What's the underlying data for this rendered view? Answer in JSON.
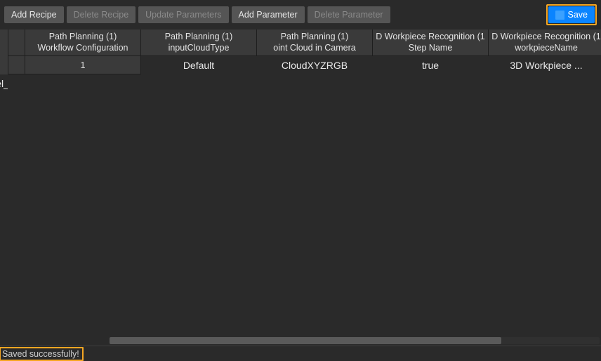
{
  "toolbar": {
    "add_recipe": "Add Recipe",
    "delete_recipe": "Delete Recipe",
    "update_parameters": "Update Parameters",
    "add_parameter": "Add Parameter",
    "delete_parameter": "Delete Parameter",
    "save": "Save"
  },
  "table": {
    "columns": [
      {
        "line1": "Path Planning (1)",
        "line2": "Workflow Configuration"
      },
      {
        "line1": "Path Planning (1)",
        "line2": "inputCloudType"
      },
      {
        "line1": "Path Planning (1)",
        "line2": "oint Cloud in Camera"
      },
      {
        "line1": "D Workpiece Recognition (1",
        "line2": "Step Name"
      },
      {
        "line1": "D Workpiece Recognition (1",
        "line2": "workpieceName"
      }
    ],
    "rows": [
      {
        "index": "1",
        "cells": [
          "Default",
          "CloudXYZRGB",
          "true",
          "3D Workpiece ...",
          "model_edge"
        ]
      }
    ]
  },
  "status": {
    "message": "Saved successfully!"
  }
}
